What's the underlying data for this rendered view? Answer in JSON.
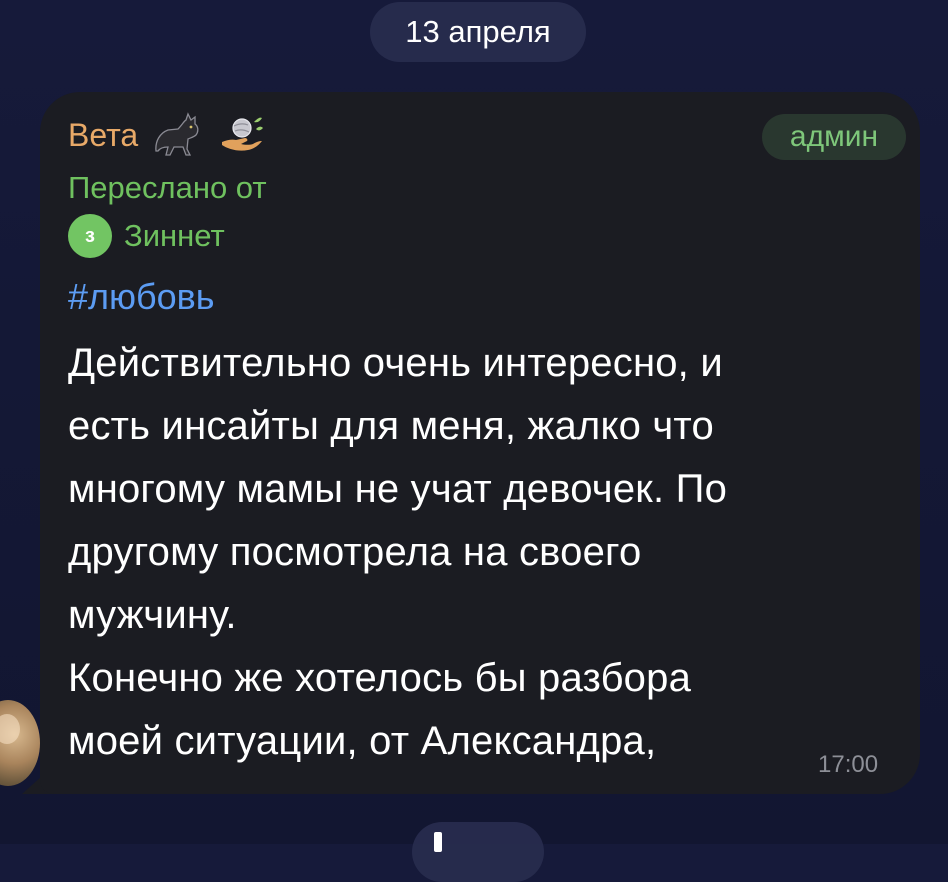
{
  "chat": {
    "date_label": "13 апреля"
  },
  "message": {
    "sender": "Вета",
    "sender_badge": "админ",
    "forwarded_label": "Переслано от",
    "forwarded_from": "Зиннет",
    "forwarded_avatar_text": "з",
    "hashtag": "#любовь",
    "lines": [
      "Действительно очень интересно, и",
      "есть инсайты для меня, жалко что",
      "многому мамы не учат девочек. По",
      "другому посмотрела на своего",
      "мужчину.",
      "Конечно же хотелось бы разбора",
      "моей ситуации, от Александра,"
    ],
    "time": "17:00",
    "sender_emojis": [
      "cat-icon",
      "hands-with-globe-icon"
    ]
  },
  "colors": {
    "background": "#141836",
    "bubble": "#1b1c22",
    "sender_name": "#e8a968",
    "forwarded": "#6fc15f",
    "hashtag": "#5c9cf3",
    "time": "#8d8f97"
  }
}
